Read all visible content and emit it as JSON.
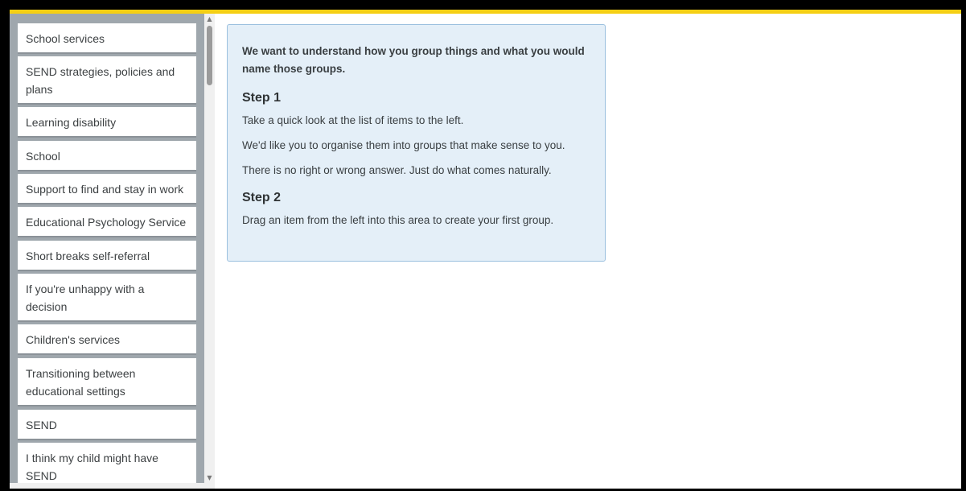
{
  "sidebar": {
    "items": [
      "School services",
      "SEND strategies, policies and plans",
      "Learning disability",
      "School",
      "Support to find and stay in work",
      "Educational Psychology Service",
      "Short breaks self-referral",
      "If you're unhappy with a decision",
      "Children's services",
      "Transitioning between educational settings",
      "SEND",
      "I think my child might have SEND"
    ]
  },
  "instructions": {
    "intro": "We want to understand how you group things and what you would name those groups.",
    "step1_title": "Step 1",
    "step1_lines": [
      "Take a quick look at the list of items to the left.",
      "We'd like you to organise them into groups that make sense to you.",
      "There is no right or wrong answer. Just do what comes naturally."
    ],
    "step2_title": "Step 2",
    "step2_lines": [
      "Drag an item from the left into this area to create your first group."
    ]
  },
  "icons": {
    "scroll_up": "triangle-up-icon",
    "scroll_down": "triangle-down-icon"
  },
  "colors": {
    "accent_bar": "#f5cf14",
    "sidebar_bg": "#9fa7ad",
    "panel_bg": "#e4eff8",
    "panel_border": "#9bc0df"
  }
}
